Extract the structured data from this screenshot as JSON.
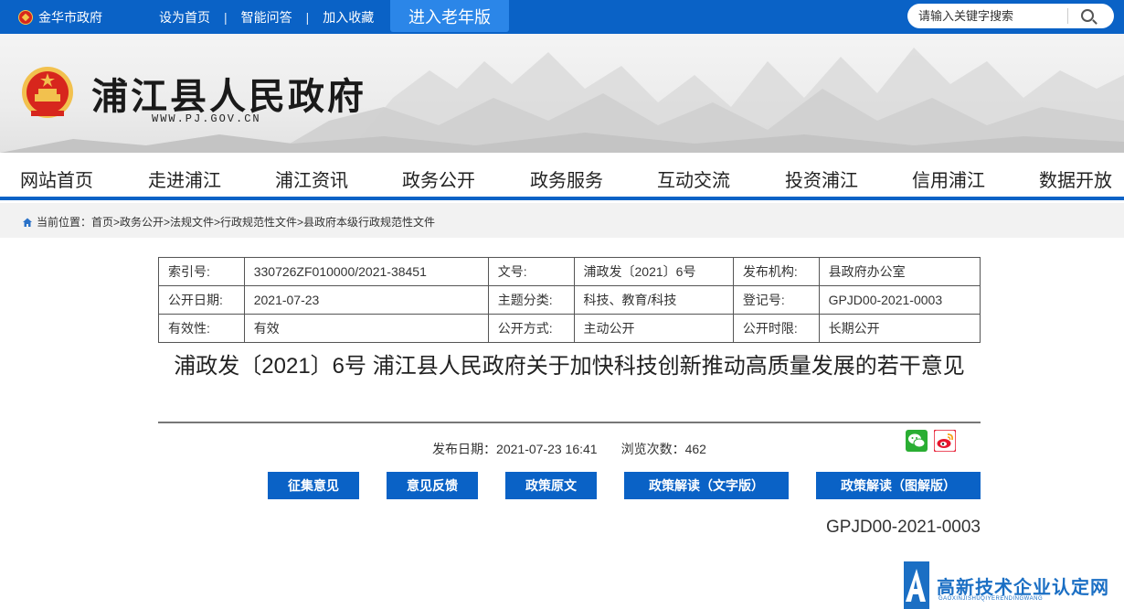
{
  "topbar": {
    "gov_link": "金华市政府",
    "links": [
      "设为首页",
      "智能问答",
      "加入收藏"
    ],
    "elder_button": "进入老年版",
    "search_placeholder": "请输入关键字搜索"
  },
  "header": {
    "title": "浦江县人民政府",
    "url": "WWW.PJ.GOV.CN"
  },
  "nav": {
    "items": [
      "网站首页",
      "走进浦江",
      "浦江资讯",
      "政务公开",
      "政务服务",
      "互动交流",
      "投资浦江",
      "信用浦江",
      "数据开放"
    ]
  },
  "breadcrumb": {
    "prefix": "当前位置：",
    "path": "首页>政务公开>法规文件>行政规范性文件>县政府本级行政规范性文件"
  },
  "meta": {
    "rows": [
      [
        {
          "k": "索引号:",
          "v": "330726ZF010000/2021-38451"
        },
        {
          "k": "文号:",
          "v": "浦政发〔2021〕6号"
        },
        {
          "k": "发布机构:",
          "v": "县政府办公室"
        }
      ],
      [
        {
          "k": "公开日期:",
          "v": "2021-07-23"
        },
        {
          "k": "主题分类:",
          "v": "科技、教育/科技"
        },
        {
          "k": "登记号:",
          "v": "GPJD00-2021-0003"
        }
      ],
      [
        {
          "k": "有效性:",
          "v": "有效"
        },
        {
          "k": "公开方式:",
          "v": "主动公开"
        },
        {
          "k": "公开时限:",
          "v": "长期公开"
        }
      ]
    ]
  },
  "doc": {
    "title": "浦政发〔2021〕6号 浦江县人民政府关于加快科技创新推动高质量发展的若干意见",
    "publish": "发布日期：2021-07-23 16:41",
    "views": "浏览次数：462",
    "reg_number": "GPJD00-2021-0003"
  },
  "buttons": [
    "征集意见",
    "意见反馈",
    "政策原文",
    "政策解读（文字版）",
    "政策解读（图解版）"
  ],
  "watermark": {
    "text": "高新技术企业认定网",
    "sub": "GAOXINJISHUQIYERENDINGWANG"
  },
  "colors": {
    "primary": "#0a62c6",
    "elder_bg": "#2b86e8"
  }
}
